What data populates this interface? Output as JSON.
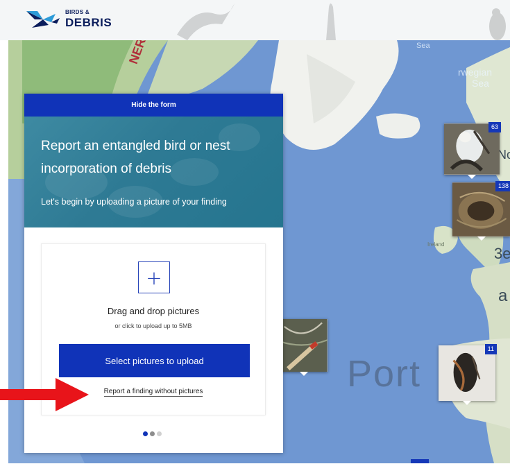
{
  "header": {
    "logo_small": "BIRDS &",
    "logo_big": "DEBRIS"
  },
  "map": {
    "labels": {
      "sea_top": "Sea",
      "norwegian_1": "rwegian",
      "norwegian_2": "Sea",
      "ireland": "Ireland",
      "portugal_fragment": "Port",
      "be_fragment": "3e",
      "a_fragment": "a",
      "no_fragment": "No",
      "left_fragment": "NERIC"
    },
    "markers": [
      {
        "badge": "63",
        "subject": "gannet-with-debris"
      },
      {
        "badge": "138",
        "subject": "nest-with-debris"
      },
      {
        "badge": "",
        "subject": "nest-material-closeup"
      },
      {
        "badge": "11",
        "subject": "dead-bird-entangled"
      }
    ]
  },
  "form": {
    "hide_label": "Hide the form",
    "title": "Report an entangled bird or nest incorporation of debris",
    "subtitle": "Let's begin by uploading a picture of your finding",
    "drop_title": "Drag and drop pictures",
    "drop_sub": "or click to upload up to 5MB",
    "select_button": "Select pictures to upload",
    "no_picture_link": "Report a finding without pictures",
    "plus_symbol": "+",
    "steps": {
      "total": 3,
      "active": 1
    }
  },
  "colors": {
    "brand_blue": "#1033b8",
    "hero_teal": "#2e7a94",
    "ocean": "#6f97d2",
    "arrow_red": "#e8141a"
  }
}
